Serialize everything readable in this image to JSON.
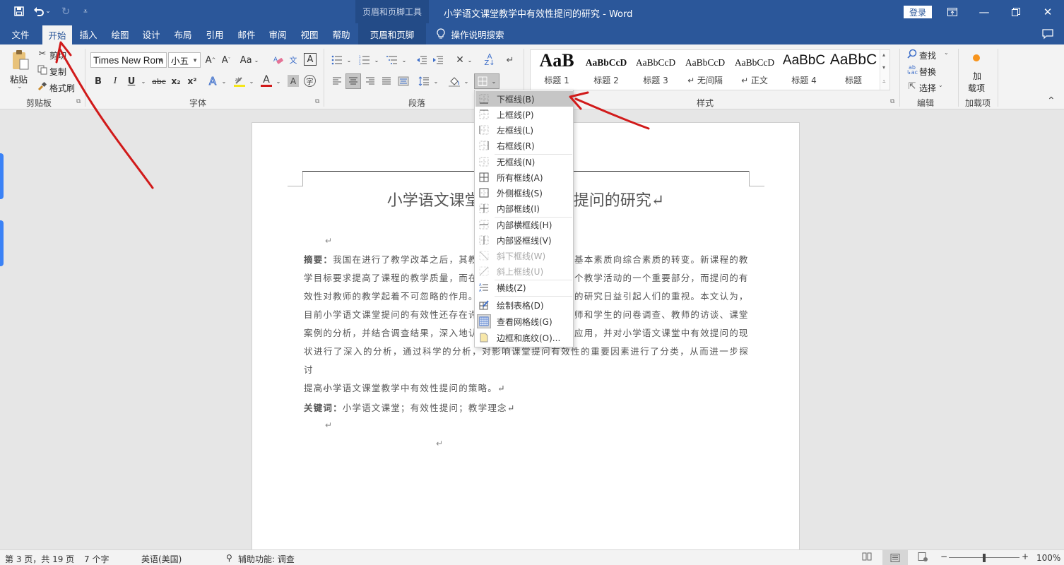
{
  "titlebar": {
    "context_tool_label": "页眉和页脚工具",
    "document_title": "小学语文课堂教学中有效性提问的研究 - Word",
    "login_label": "登录",
    "icons": [
      "save-icon",
      "undo-icon",
      "redo-icon",
      "customize-qat-icon",
      "ribbon-display-icon",
      "minimize-icon",
      "restore-icon",
      "close-icon"
    ]
  },
  "tabs": [
    {
      "label": "文件",
      "active": false
    },
    {
      "label": "开始",
      "active": true
    },
    {
      "label": "插入",
      "active": false
    },
    {
      "label": "绘图",
      "active": false
    },
    {
      "label": "设计",
      "active": false
    },
    {
      "label": "布局",
      "active": false
    },
    {
      "label": "引用",
      "active": false
    },
    {
      "label": "邮件",
      "active": false
    },
    {
      "label": "审阅",
      "active": false
    },
    {
      "label": "视图",
      "active": false
    },
    {
      "label": "帮助",
      "active": false
    },
    {
      "label": "页眉和页脚",
      "active": false
    }
  ],
  "tell_me": "操作说明搜索",
  "ribbon": {
    "clipboard": {
      "paste": "粘贴",
      "cut": "剪切",
      "copy": "复制",
      "format_painter": "格式刷",
      "group_label": "剪贴板"
    },
    "font": {
      "font_name": "Times New Rom",
      "font_size": "小五",
      "change_case": "Aa",
      "bold": "B",
      "italic": "I",
      "underline": "U",
      "strikethrough": "abc",
      "subscript": "x₂",
      "superscript": "x²",
      "char_border": "A",
      "char_shading": "A",
      "font_color": "A",
      "group_label": "字体"
    },
    "paragraph": {
      "group_label": "段落"
    },
    "styles": {
      "items": [
        {
          "sample": "AaB",
          "name": "标题 1"
        },
        {
          "sample": "AaBbCcD",
          "name": "标题 2"
        },
        {
          "sample": "AaBbCcD",
          "name": "标题 3"
        },
        {
          "sample": "AaBbCcD",
          "name": "↵ 无间隔"
        },
        {
          "sample": "AaBbCcD",
          "name": "↵ 正文"
        },
        {
          "sample": "AaBbC",
          "name": "标题 4"
        },
        {
          "sample": "AaBbC",
          "name": "标题"
        }
      ],
      "group_label": "样式"
    },
    "editing": {
      "find": "查找",
      "replace": "替换",
      "select": "选择",
      "group_label": "编辑"
    },
    "addins": {
      "button": "加载项",
      "button_line1": "加",
      "button_line2": "载项",
      "group_label": "加载项"
    }
  },
  "border_menu": {
    "items": [
      {
        "label": "下框线(B)",
        "icon": "bottom-border-icon",
        "state": "highlighted"
      },
      {
        "label": "上框线(P)",
        "icon": "top-border-icon",
        "state": "normal"
      },
      {
        "label": "左框线(L)",
        "icon": "left-border-icon",
        "state": "normal"
      },
      {
        "label": "右框线(R)",
        "icon": "right-border-icon",
        "state": "normal"
      },
      {
        "label": "无框线(N)",
        "icon": "no-border-icon",
        "state": "normal"
      },
      {
        "label": "所有框线(A)",
        "icon": "all-borders-icon",
        "state": "normal"
      },
      {
        "label": "外侧框线(S)",
        "icon": "outside-borders-icon",
        "state": "normal"
      },
      {
        "label": "内部框线(I)",
        "icon": "inside-borders-icon",
        "state": "normal"
      },
      {
        "label": "内部横框线(H)",
        "icon": "inside-horizontal-border-icon",
        "state": "normal"
      },
      {
        "label": "内部竖框线(V)",
        "icon": "inside-vertical-border-icon",
        "state": "normal"
      },
      {
        "label": "斜下框线(W)",
        "icon": "diagonal-down-border-icon",
        "state": "disabled"
      },
      {
        "label": "斜上框线(U)",
        "icon": "diagonal-up-border-icon",
        "state": "disabled"
      },
      {
        "label": "横线(Z)",
        "icon": "horizontal-line-icon",
        "state": "normal"
      },
      {
        "label": "绘制表格(D)",
        "icon": "draw-table-icon",
        "state": "normal"
      },
      {
        "label": "查看网格线(G)",
        "icon": "view-gridlines-icon",
        "state": "normal"
      },
      {
        "label": "边框和底纹(O)...",
        "icon": "borders-shading-icon",
        "state": "normal"
      }
    ]
  },
  "document": {
    "title": "小学语文课堂教学中有效性提问的研究↵",
    "abstract_label": "摘要：",
    "abstract_lines": [
      "我国在进行了教学改革之后，其教",
      "学目标要求提高了课程的教学质量，而在",
      "效性对教师的教学起着不可忽略的作用。",
      "目前小学语文课堂提问的有效性还存在许",
      "案例的分析，并结合调查结果，深入地认",
      "状进行了深入的分析，通过科学的分析，对影响课堂提问有效性的重要因素进行了分类，从而进一步探讨",
      "提高小学语文课堂教学中有效性提问的策略。↵"
    ],
    "abstract_right_lines": [
      "基本素质向综合素质的转变。新课程的教",
      "个教学活动的一个重要部分，而提问的有",
      "的研究日益引起人们的重视。本文认为，",
      "师和学生的问卷调查、教师的访谈、课堂",
      "应用，并对小学语文课堂中有效提问的现"
    ],
    "keywords_label": "关键词：",
    "keywords": "小学语文课堂；有效性提问；教学理念↵",
    "paragraph_mark": "↵"
  },
  "statusbar": {
    "page": "第 3 页，共 19 页",
    "words": "7 个字",
    "language": "英语(美国)",
    "accessibility": "辅助功能: 调查",
    "zoom": "100%",
    "zoom_level_percent": 100
  },
  "colors": {
    "brand": "#2b579a",
    "annotation": "#d11a1a"
  }
}
